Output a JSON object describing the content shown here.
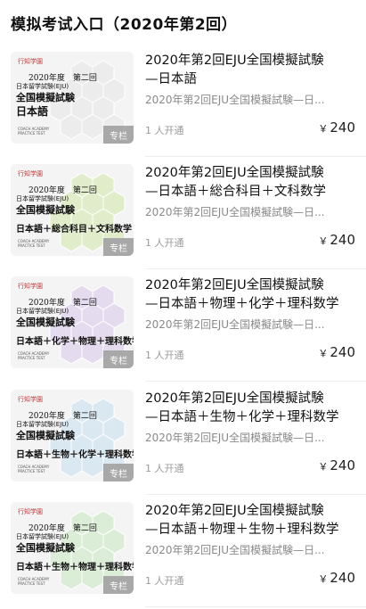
{
  "page": {
    "title": "模拟考试入口（2020年第2回）"
  },
  "items": [
    {
      "thumb": {
        "logo": "行知学園",
        "year": "2020年度　第二回",
        "jp1": "日本留学試験(EJU)",
        "jp2": "全国模擬試験",
        "subject": "日本語",
        "coach": "COACH ACADEMY PRACTICE TEST",
        "badge": "专栏",
        "accent": "#e6e6e6"
      },
      "title_line1": "2020年第2回EJU全国模擬試験",
      "title_line2": "—日本語",
      "subtitle": "2020年第2回EJU全国模擬試験—日...",
      "buyers": "1 人开通",
      "price_symbol": "￥",
      "price": "240"
    },
    {
      "thumb": {
        "logo": "行知学園",
        "year": "2020年度　第二回",
        "jp1": "日本留学試験(EJU)",
        "jp2": "全国模擬試験",
        "subject": "日本語＋総合科目＋文科数学",
        "coach": "COACH ACADEMY PRACTICE TEST",
        "badge": "专栏",
        "accent": "#cfe6a8"
      },
      "title_line1": "2020年第2回EJU全国模擬試験",
      "title_line2": "—日本語＋総合科目＋文科数学",
      "subtitle": "2020年第2回EJU全国模擬試験—日...",
      "buyers": "1 人开通",
      "price_symbol": "￥",
      "price": "240"
    },
    {
      "thumb": {
        "logo": "行知学園",
        "year": "2020年度　第二回",
        "jp1": "日本留学試験(EJU)",
        "jp2": "全国模擬試験",
        "subject": "日本語＋化学＋物理＋理科数学",
        "coach": "COACH ACADEMY PRACTICE TEST",
        "badge": "专栏",
        "accent": "#d9c6ea"
      },
      "title_line1": "2020年第2回EJU全国模擬試験",
      "title_line2": "—日本語＋物理＋化学＋理科数学",
      "subtitle": "2020年第2回EJU全国模擬試験—日...",
      "buyers": "1 人开通",
      "price_symbol": "￥",
      "price": "240"
    },
    {
      "thumb": {
        "logo": "行知学園",
        "year": "2020年度　第二回",
        "jp1": "日本留学試験(EJU)",
        "jp2": "全国模擬試験",
        "subject": "日本語＋生物＋化学＋理科数学",
        "coach": "COACH ACADEMY PRACTICE TEST",
        "badge": "专栏",
        "accent": "#c4dff0"
      },
      "title_line1": "2020年第2回EJU全国模擬試験",
      "title_line2": "—日本語＋生物＋化学＋理科数学",
      "subtitle": "2020年第2回EJU全国模擬試験—日...",
      "buyers": "1 人开通",
      "price_symbol": "￥",
      "price": "240"
    },
    {
      "thumb": {
        "logo": "行知学園",
        "year": "2020年度　第二回",
        "jp1": "日本留学試験(EJU)",
        "jp2": "全国模擬試験",
        "subject": "日本語＋生物＋物理＋理科数学",
        "coach": "COACH ACADEMY PRACTICE TEST",
        "badge": "专栏",
        "accent": "#c9e7c0"
      },
      "title_line1": "2020年第2回EJU全国模擬試験",
      "title_line2": "—日本語＋物理＋生物＋理科数学",
      "subtitle": "2020年第2回EJU全国模擬試験—日...",
      "buyers": "1 人开通",
      "price_symbol": "￥",
      "price": "240"
    }
  ]
}
